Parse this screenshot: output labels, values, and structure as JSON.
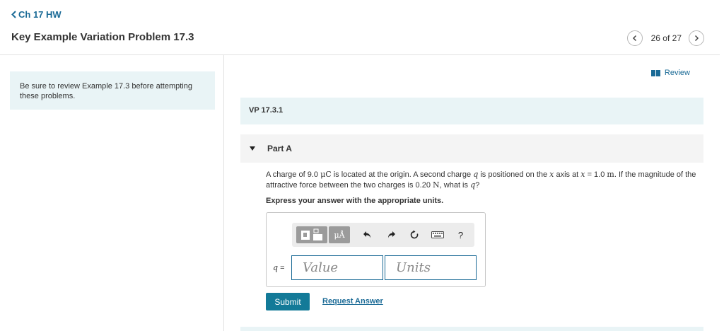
{
  "nav": {
    "back_label": "Ch 17 HW"
  },
  "header": {
    "title": "Key Example Variation Problem 17.3"
  },
  "pager": {
    "position": "26 of 27"
  },
  "sidebar": {
    "note": "Be sure to review Example 17.3 before attempting these problems."
  },
  "review": {
    "label": "Review"
  },
  "section": {
    "label": "VP 17.3.1"
  },
  "part": {
    "label": "Part A"
  },
  "question": {
    "t1": "A charge of 9.0 ",
    "m1": "μC",
    "t2": " is located at the origin. A second charge ",
    "v1": "q",
    "t3": " is positioned on the ",
    "v2": "x",
    "t4": " axis at ",
    "v3": "x",
    "t5": " = 1.0 ",
    "m2": "m",
    "t6": ". If the magnitude of the attractive force between the two charges is 0.20 ",
    "m3": "N",
    "t7": ", what is ",
    "v4": "q",
    "t8": "?"
  },
  "instruction": "Express your answer with the appropriate units.",
  "toolbar": {
    "units_button": "μÅ",
    "help": "?"
  },
  "answer": {
    "var_label": "q",
    "equals": "=",
    "value_placeholder": "Value",
    "units_placeholder": "Units"
  },
  "actions": {
    "submit": "Submit",
    "request_answer": "Request Answer"
  },
  "colors": {
    "accent": "#1a6a96",
    "submit_bg": "#137a98",
    "panel_bg": "#e9f4f6"
  }
}
